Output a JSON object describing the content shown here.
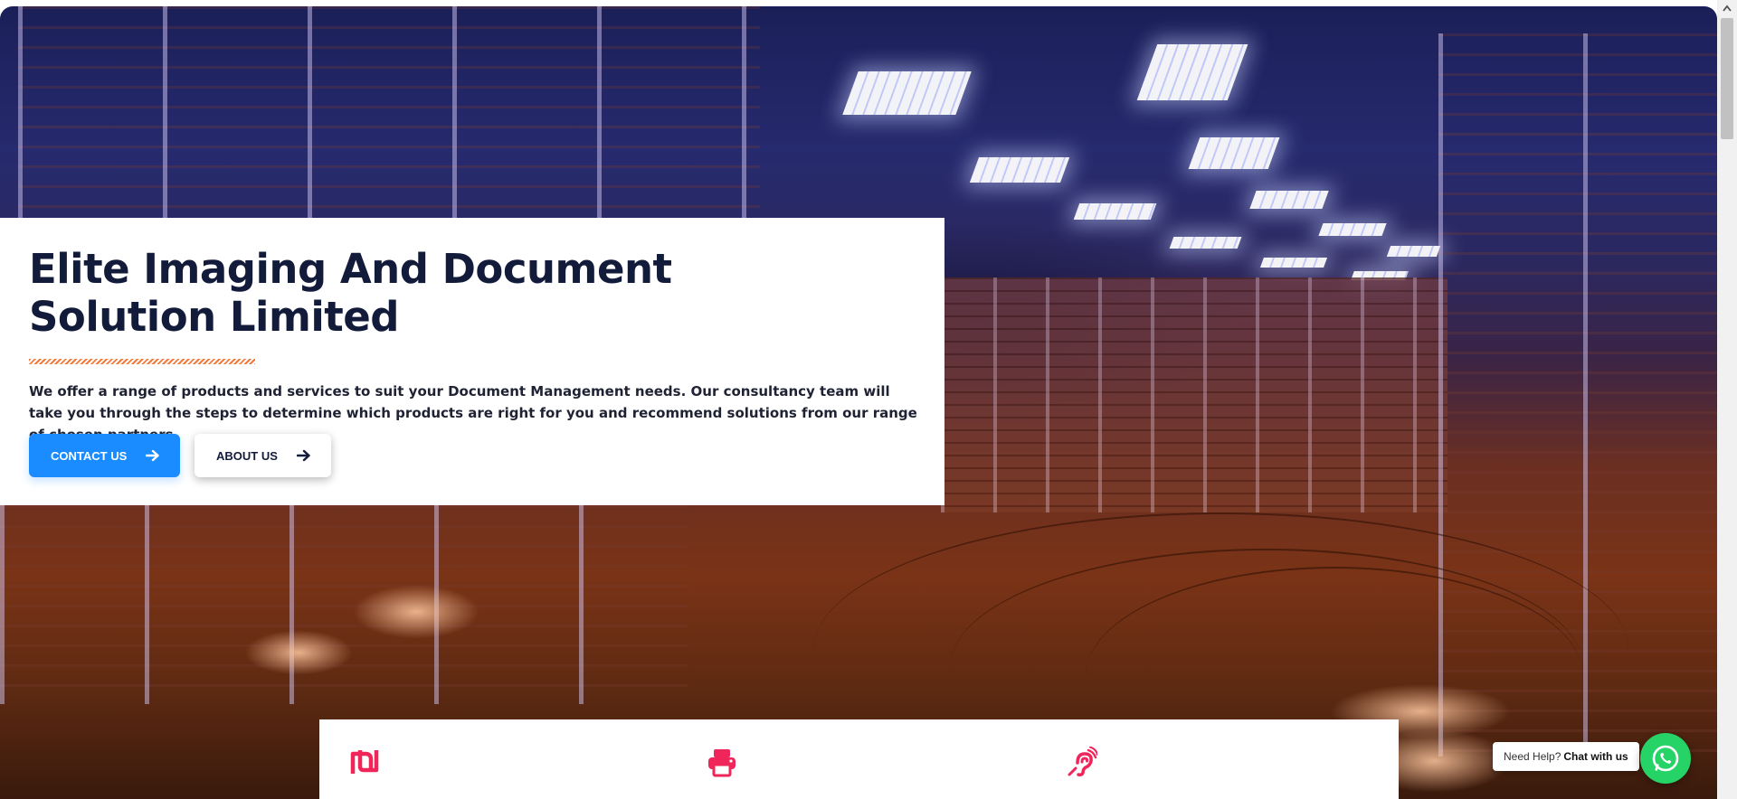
{
  "hero": {
    "title": "Elite Imaging And Document Solution Limited",
    "description": "We offer a range of products and services to suit your Document Management needs. Our consultancy team will take you through the steps to determine which products are right for you and recommend solutions from our range of chosen partners",
    "primary_button": "CONTACT US",
    "secondary_button": "ABOUT US",
    "divider_color": "#f47a3b",
    "primary_color": "#1a8cff",
    "title_color": "#131b3b"
  },
  "features": {
    "icons": [
      "shekel-icon",
      "printer-icon",
      "hearing-assistance-icon"
    ],
    "icon_color": "#f0255a"
  },
  "whatsapp": {
    "prefix": "Need Help?",
    "label": "Chat with us",
    "color": "#25d366"
  }
}
